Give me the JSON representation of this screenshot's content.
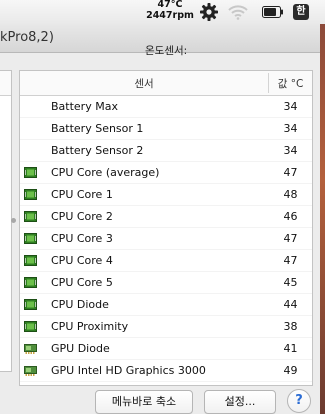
{
  "menubar": {
    "cpu_temp": "47°C",
    "fan_rpm": "2447rpm",
    "ime_label": "한",
    "icons": [
      "gear-icon",
      "wifi-icon",
      "battery-icon",
      "input-method-icon"
    ]
  },
  "window": {
    "title_fragment": "kPro8,2)",
    "section_label": "온도센서:"
  },
  "table": {
    "columns": {
      "name": "센서",
      "value": "값 °C"
    },
    "rows": [
      {
        "name": "Battery Max",
        "value": "34",
        "icon": ""
      },
      {
        "name": "Battery Sensor 1",
        "value": "34",
        "icon": ""
      },
      {
        "name": "Battery Sensor 2",
        "value": "34",
        "icon": ""
      },
      {
        "name": "CPU Core (average)",
        "value": "47",
        "icon": "cpu-chip-icon"
      },
      {
        "name": "CPU Core 1",
        "value": "48",
        "icon": "cpu-chip-icon"
      },
      {
        "name": "CPU Core 2",
        "value": "46",
        "icon": "cpu-chip-icon"
      },
      {
        "name": "CPU Core 3",
        "value": "47",
        "icon": "cpu-chip-icon"
      },
      {
        "name": "CPU Core 4",
        "value": "47",
        "icon": "cpu-chip-icon"
      },
      {
        "name": "CPU Core 5",
        "value": "45",
        "icon": "cpu-chip-icon"
      },
      {
        "name": "CPU Diode",
        "value": "44",
        "icon": "cpu-chip-icon"
      },
      {
        "name": "CPU Proximity",
        "value": "38",
        "icon": "cpu-chip-icon"
      },
      {
        "name": "GPU Diode",
        "value": "41",
        "icon": "gpu-card-icon"
      },
      {
        "name": "GPU Intel HD Graphics 3000",
        "value": "49",
        "icon": "gpu-card-icon"
      }
    ]
  },
  "buttons": {
    "shrink_to_menubar": "메뉴바로 축소",
    "settings": "설정...",
    "help": "?"
  },
  "colors": {
    "chip_green": "#3b9a2c",
    "gpu_green": "#4a8c3a",
    "help_blue": "#2b6cd4"
  }
}
